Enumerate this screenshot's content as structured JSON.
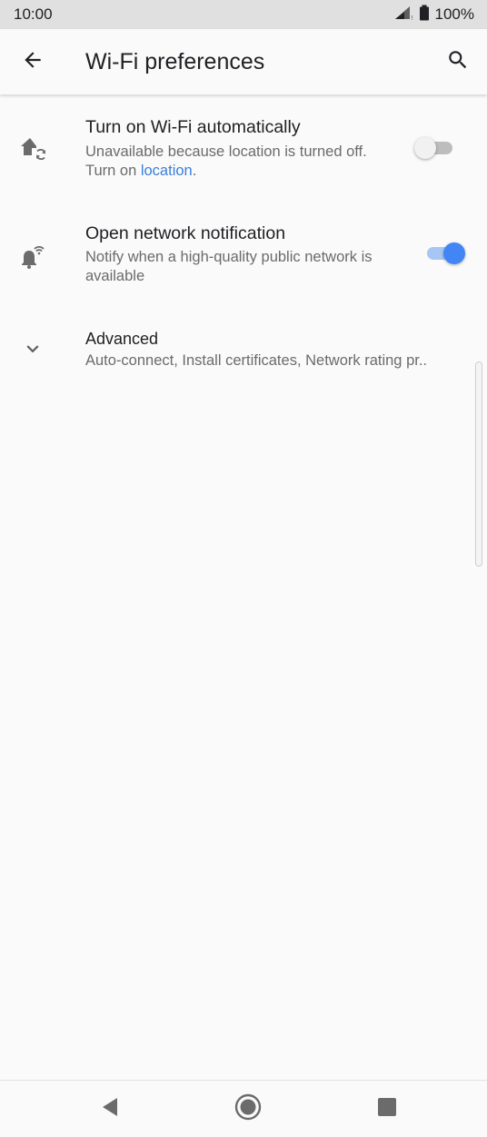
{
  "status_bar": {
    "time": "10:00",
    "battery": "100%",
    "icons": [
      "signal-icon",
      "battery-icon"
    ]
  },
  "app_bar": {
    "title": "Wi-Fi preferences",
    "back_icon": "back-arrow-icon",
    "search_icon": "search-icon"
  },
  "preferences": [
    {
      "icon": "home-wifi-sync-icon",
      "title": "Turn on Wi-Fi automatically",
      "summary_text": "Unavailable because location is turned off. Turn on ",
      "summary_link": "location",
      "summary_end": ".",
      "toggle_on": false
    },
    {
      "icon": "notification-wifi-icon",
      "title": "Open network notification",
      "summary_text": "Notify when a high-quality public network is available",
      "toggle_on": true
    },
    {
      "icon": "chevron-down-icon",
      "title": "Advanced",
      "summary_text": "Auto-connect, Install certificates, Network rating pr.."
    }
  ],
  "colors": {
    "accent": "#4285f4",
    "link": "#3b7fd9",
    "status_bar_bg": "#e0e0e0",
    "background": "#fafafa"
  },
  "nav_bar": {
    "icons": [
      "back-triangle-icon",
      "home-circle-icon",
      "recents-square-icon"
    ]
  }
}
